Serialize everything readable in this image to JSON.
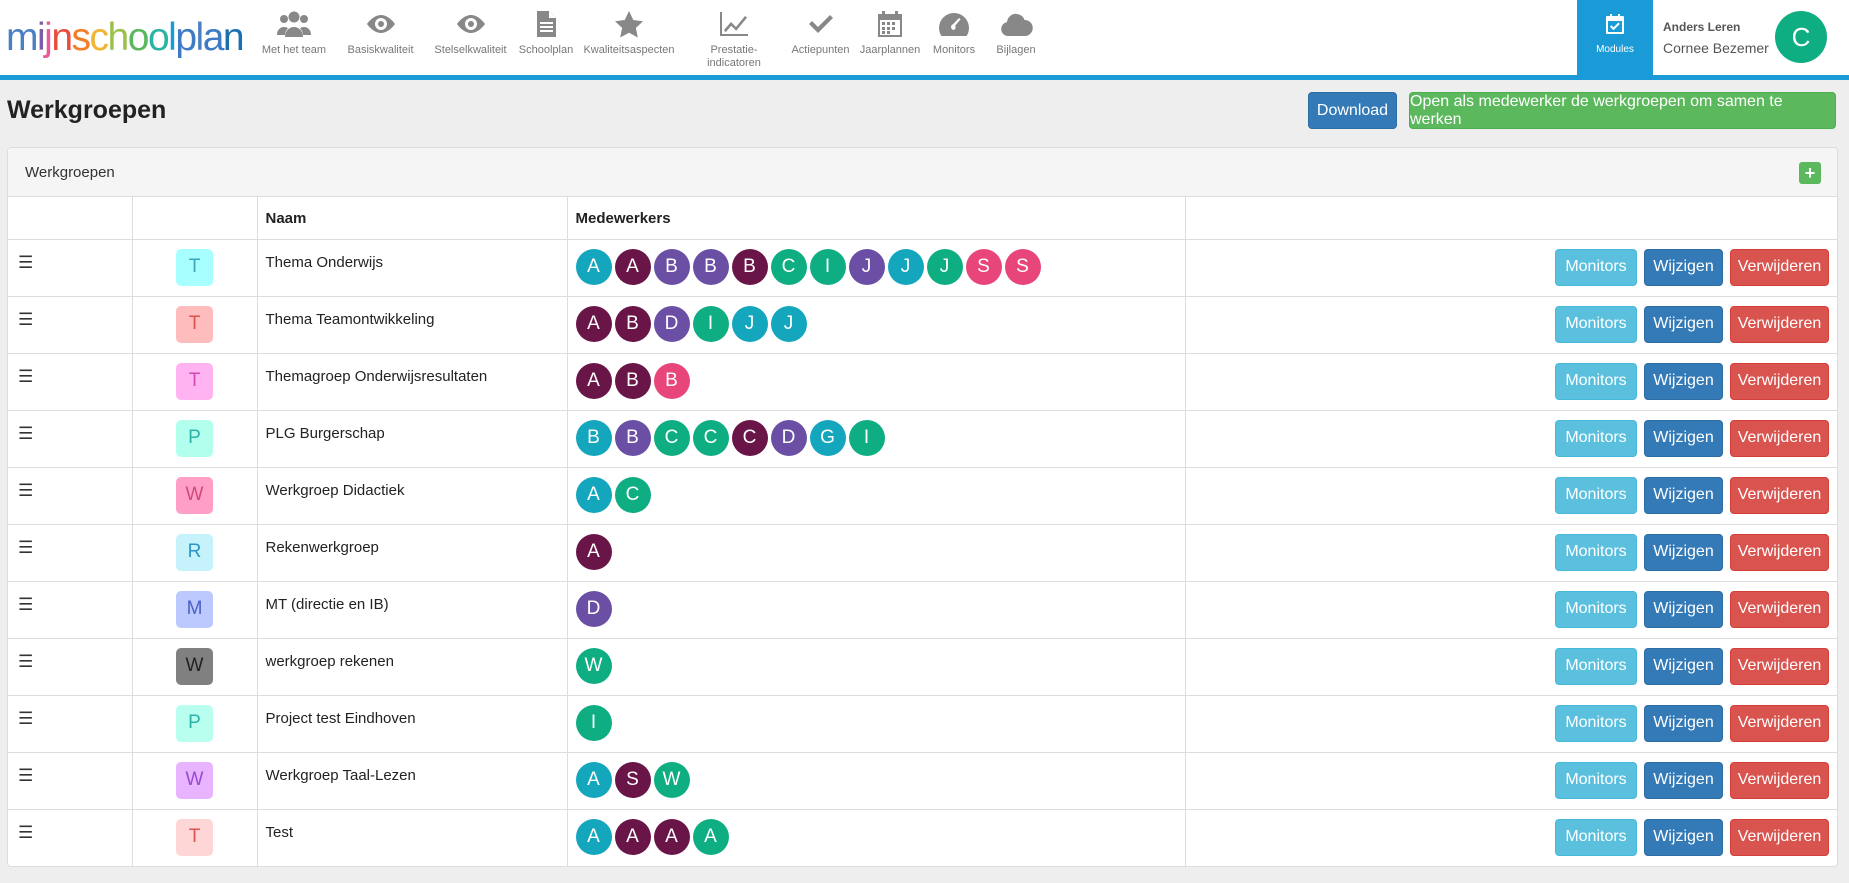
{
  "brand": {
    "logo_parts": [
      {
        "text": "m",
        "color": "#4a7fc1"
      },
      {
        "text": "i",
        "color": "#7b5ea7"
      },
      {
        "text": "j",
        "color": "#e85a9a"
      },
      {
        "text": "n",
        "color": "#e84c3d"
      },
      {
        "text": "s",
        "color": "#f07f2a"
      },
      {
        "text": "c",
        "color": "#f1b434"
      },
      {
        "text": "h",
        "color": "#9cc14a"
      },
      {
        "text": "o",
        "color": "#5cb85c"
      },
      {
        "text": "o",
        "color": "#2bb3a5"
      },
      {
        "text": "l",
        "color": "#1a9bd7"
      },
      {
        "text": "p",
        "color": "#3e7bc4"
      },
      {
        "text": "l",
        "color": "#4a7fc1"
      },
      {
        "text": "a",
        "color": "#3e7bc4"
      },
      {
        "text": "n",
        "color": "#1a6fb0"
      }
    ]
  },
  "nav": [
    {
      "key": "team",
      "label": "Met het team",
      "icon": "team-icon"
    },
    {
      "key": "basis",
      "label": "Basiskwaliteit",
      "icon": "eye-icon"
    },
    {
      "key": "stelsel",
      "label": "Stelselkwaliteit",
      "icon": "eye-icon"
    },
    {
      "key": "schoolplan",
      "label": "Schoolplan",
      "icon": "document-icon"
    },
    {
      "key": "kwaliteit",
      "label": "Kwaliteitsaspecten",
      "icon": "star-icon"
    },
    {
      "key": "prestatie",
      "label": "Prestatie-\nindicatoren",
      "icon": "line-chart-icon"
    },
    {
      "key": "actie",
      "label": "Actiepunten",
      "icon": "check-icon"
    },
    {
      "key": "jaar",
      "label": "Jaarplannen",
      "icon": "calendar-icon"
    },
    {
      "key": "monitors",
      "label": "Monitors",
      "icon": "dashboard-icon"
    },
    {
      "key": "bijlagen",
      "label": "Bijlagen",
      "icon": "cloud-icon"
    }
  ],
  "modules": {
    "label": "Modules",
    "icon": "calendar-check-icon"
  },
  "user": {
    "company": "Anders Leren",
    "name": "Cornee Bezemer",
    "initial": "C",
    "avatar_color": "#0fae82"
  },
  "page": {
    "title": "Werkgroepen"
  },
  "actions": {
    "download": "Download",
    "open": "Open als medewerker de werkgroepen om samen te werken"
  },
  "panel": {
    "title": "Werkgroepen",
    "add": "+"
  },
  "table": {
    "headers": [
      "",
      "",
      "Naam",
      "Medewerkers",
      ""
    ],
    "row_buttons": {
      "monitors": "Monitors",
      "edit": "Wijzigen",
      "delete": "Verwijderen"
    },
    "rows": [
      {
        "letter": "T",
        "badge_bg": "#a8ffff",
        "badge_fg": "#3aa6b8",
        "name": "Thema Onderwijs",
        "members": [
          "A",
          "A",
          "B",
          "B",
          "B",
          "C",
          "I",
          "J",
          "J",
          "J",
          "S",
          "S"
        ]
      },
      {
        "letter": "T",
        "badge_bg": "#ffbcbc",
        "badge_fg": "#d9534f",
        "name": "Thema Teamontwikkeling",
        "members": [
          "A",
          "B",
          "D",
          "I",
          "J",
          "J"
        ]
      },
      {
        "letter": "T",
        "badge_bg": "#ffb3f0",
        "badge_fg": "#d14ab3",
        "name": "Themagroep Onderwijsresultaten",
        "members": [
          "A",
          "B",
          "B"
        ]
      },
      {
        "letter": "P",
        "badge_bg": "#b3ffee",
        "badge_fg": "#2bb3a5",
        "name": "PLG Burgerschap",
        "members": [
          "B",
          "B",
          "C",
          "C",
          "C",
          "D",
          "G",
          "I"
        ]
      },
      {
        "letter": "W",
        "badge_bg": "#ff9fc7",
        "badge_fg": "#d14a7a",
        "name": "Werkgroep Didactiek",
        "members": [
          "A",
          "C"
        ]
      },
      {
        "letter": "R",
        "badge_bg": "#c6f2fb",
        "badge_fg": "#2b95c4",
        "name": "Rekenwerkgroep",
        "members": [
          "A"
        ]
      },
      {
        "letter": "M",
        "badge_bg": "#bcc9ff",
        "badge_fg": "#4a5fc4",
        "name": "MT (directie en IB)",
        "members": [
          "D"
        ]
      },
      {
        "letter": "W",
        "badge_bg": "#808080",
        "badge_fg": "#222222",
        "name": "werkgroep rekenen",
        "members": [
          "W"
        ]
      },
      {
        "letter": "P",
        "badge_bg": "#b8fff0",
        "badge_fg": "#2bb3a5",
        "name": "Project test Eindhoven",
        "members": [
          "I"
        ]
      },
      {
        "letter": "W",
        "badge_bg": "#e8b3ff",
        "badge_fg": "#9a4ad1",
        "name": "Werkgroep Taal-Lezen",
        "members": [
          "A",
          "S",
          "W"
        ]
      },
      {
        "letter": "T",
        "badge_bg": "#ffd6d6",
        "badge_fg": "#d9534f",
        "name": "Test",
        "members": [
          "A",
          "A",
          "A",
          "A"
        ]
      }
    ],
    "member_colors": [
      [
        "#13a6bd",
        "#6a1548",
        "#6a4fa5",
        "#6a4fa5",
        "#6a1548",
        "#0fae82",
        "#0fae82",
        "#6a4fa5",
        "#13a6bd",
        "#0fae82",
        "#e8457a",
        "#e8457a"
      ],
      [
        "#6a1548",
        "#6a1548",
        "#6a4fa5",
        "#0fae82",
        "#13a6bd",
        "#13a6bd"
      ],
      [
        "#6a1548",
        "#6a1548",
        "#e8457a"
      ],
      [
        "#13a6bd",
        "#6a4fa5",
        "#0fae82",
        "#0fae82",
        "#6a1548",
        "#6a4fa5",
        "#13a6bd",
        "#0fae82"
      ],
      [
        "#13a6bd",
        "#0fae82"
      ],
      [
        "#6a1548"
      ],
      [
        "#6a4fa5"
      ],
      [
        "#0fae82"
      ],
      [
        "#0fae82"
      ],
      [
        "#13a6bd",
        "#6a1548",
        "#0fae82"
      ],
      [
        "#13a6bd",
        "#6a1548",
        "#6a1548",
        "#0fae82"
      ]
    ]
  }
}
